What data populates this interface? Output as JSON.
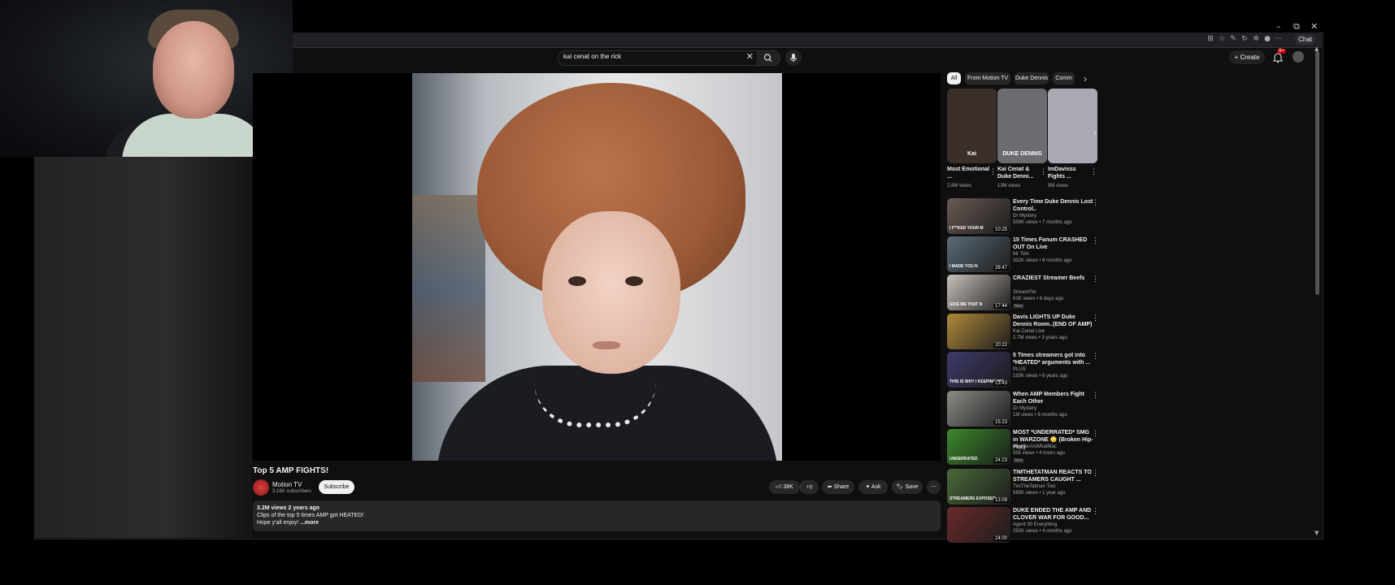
{
  "window_controls": {
    "minimize": "–",
    "restore": "⧉",
    "close": "✕"
  },
  "browser": {
    "profile_label": "Chat"
  },
  "search": {
    "value": "kai cenat on the rick",
    "clear_icon": "✕"
  },
  "header": {
    "create_label": "Create",
    "notifications_badge": "9+"
  },
  "video": {
    "title": "Top 5 AMP FIGHTS!",
    "channel_name": "Motion TV",
    "channel_subs": "3.16K subscribers",
    "subscribe_label": "Subscribe",
    "likes": "38K",
    "share_label": "Share",
    "ask_label": "Ask",
    "save_label": "Save",
    "desc_views_date": "3.2M views  2 years ago",
    "desc_text": "Clips of the top 5 times AMP got HEATED!",
    "desc_more_prefix": "Hope y'all enjoy! ",
    "desc_more": "...more"
  },
  "chips": [
    {
      "label": "All"
    },
    {
      "label": "From Motion TV"
    },
    {
      "label": "Duke Dennis"
    },
    {
      "label": "Comm"
    }
  ],
  "shorts": [
    {
      "title": "Most Emotional ...",
      "views": "2.8M views",
      "thumb_color": "#3b2f2a",
      "thumb_text": "Kai"
    },
    {
      "title": "Kai Cenat & Duke Denni...",
      "views": "13M views",
      "thumb_color": "#6b6b70",
      "thumb_text": "DUKE DENNIS"
    },
    {
      "title": "ImDavisss Fights ...",
      "views": "9M views",
      "thumb_color": "#a9a9b2",
      "thumb_text": ""
    }
  ],
  "recommendations": [
    {
      "title": "Every Time Duke Dennis Lost Control..",
      "channel": "Dr Mystery",
      "meta": "559K views • 7 months ago",
      "duration": "10:25",
      "thumb_text": "I F**KED YOUR M",
      "thumb_color": "#6a5a55",
      "is_new": false
    },
    {
      "title": "15 Times Fanum CRASHED OUT On Live",
      "channel": "Mr Tilm",
      "meta": "332K views • 8 months ago",
      "duration": "26:47",
      "thumb_text": "I MADE YOU N",
      "thumb_color": "#5b6b78",
      "is_new": false
    },
    {
      "title": "CRAZIEST Streamer Beefs",
      "channel": "StreamFlix",
      "meta": "61K views • 6 days ago",
      "duration": "17:44",
      "thumb_text": "GIVE ME THAT N",
      "thumb_color": "#c9c2bc",
      "is_new": true
    },
    {
      "title": "Davis LIGHTS UP Duke Dennis Room..(END OF AMP)",
      "channel": "Kai Cenat Live",
      "meta": "2.7M views • 3 years ago",
      "duration": "20:22",
      "thumb_text": "",
      "thumb_color": "#b08a3a",
      "is_new": false
    },
    {
      "title": "5 Times streamers got into *HEATED* arguments with ...",
      "channel": "PLUS",
      "meta": "193K views • 6 years ago",
      "duration": "13:43",
      "thumb_text": "THIS IS WHY I KEEPING MY",
      "thumb_color": "#3e3a6a",
      "is_new": false
    },
    {
      "title": "When AMP Members Fight Each Other",
      "channel": "Dr Mystery",
      "meta": "1M views • 8 months ago",
      "duration": "15:23",
      "thumb_text": "",
      "thumb_color": "#8a8a86",
      "is_new": false
    },
    {
      "title": "MOST *UNDERRATED* SMG in WARZONE 😳 (Broken Hip-Fire)",
      "channel": "MightierAsWhatMac",
      "meta": "555 views • 4 hours ago",
      "duration": "24:23",
      "thumb_text": "UNDERRATED",
      "thumb_color": "#3b8a2a",
      "is_new": true
    },
    {
      "title": "TIMTHETATMAN REACTS TO STREAMERS CAUGHT ...",
      "channel": "TimTheTatman Two",
      "meta": "585K views • 1 year ago",
      "duration": "13:09",
      "thumb_text": "STREAMERS EXPOSED",
      "thumb_color": "#4a6a3a",
      "is_new": false
    },
    {
      "title": "DUKE ENDED THE AMP AND CLOVER WAR FOR GOOD...",
      "channel": "Agent 00 Everything",
      "meta": "292K views • 4 months ago",
      "duration": "24:00",
      "thumb_text": "",
      "thumb_color": "#6a2a2a",
      "is_new": false
    }
  ],
  "icons": {
    "search": "search-icon",
    "mic": "mic-icon",
    "bell": "bell-icon",
    "like": "like-icon",
    "dislike": "dislike-icon",
    "share": "share-icon",
    "ask": "sparkle-icon",
    "save": "bookmark-icon",
    "more": "more-icon"
  }
}
